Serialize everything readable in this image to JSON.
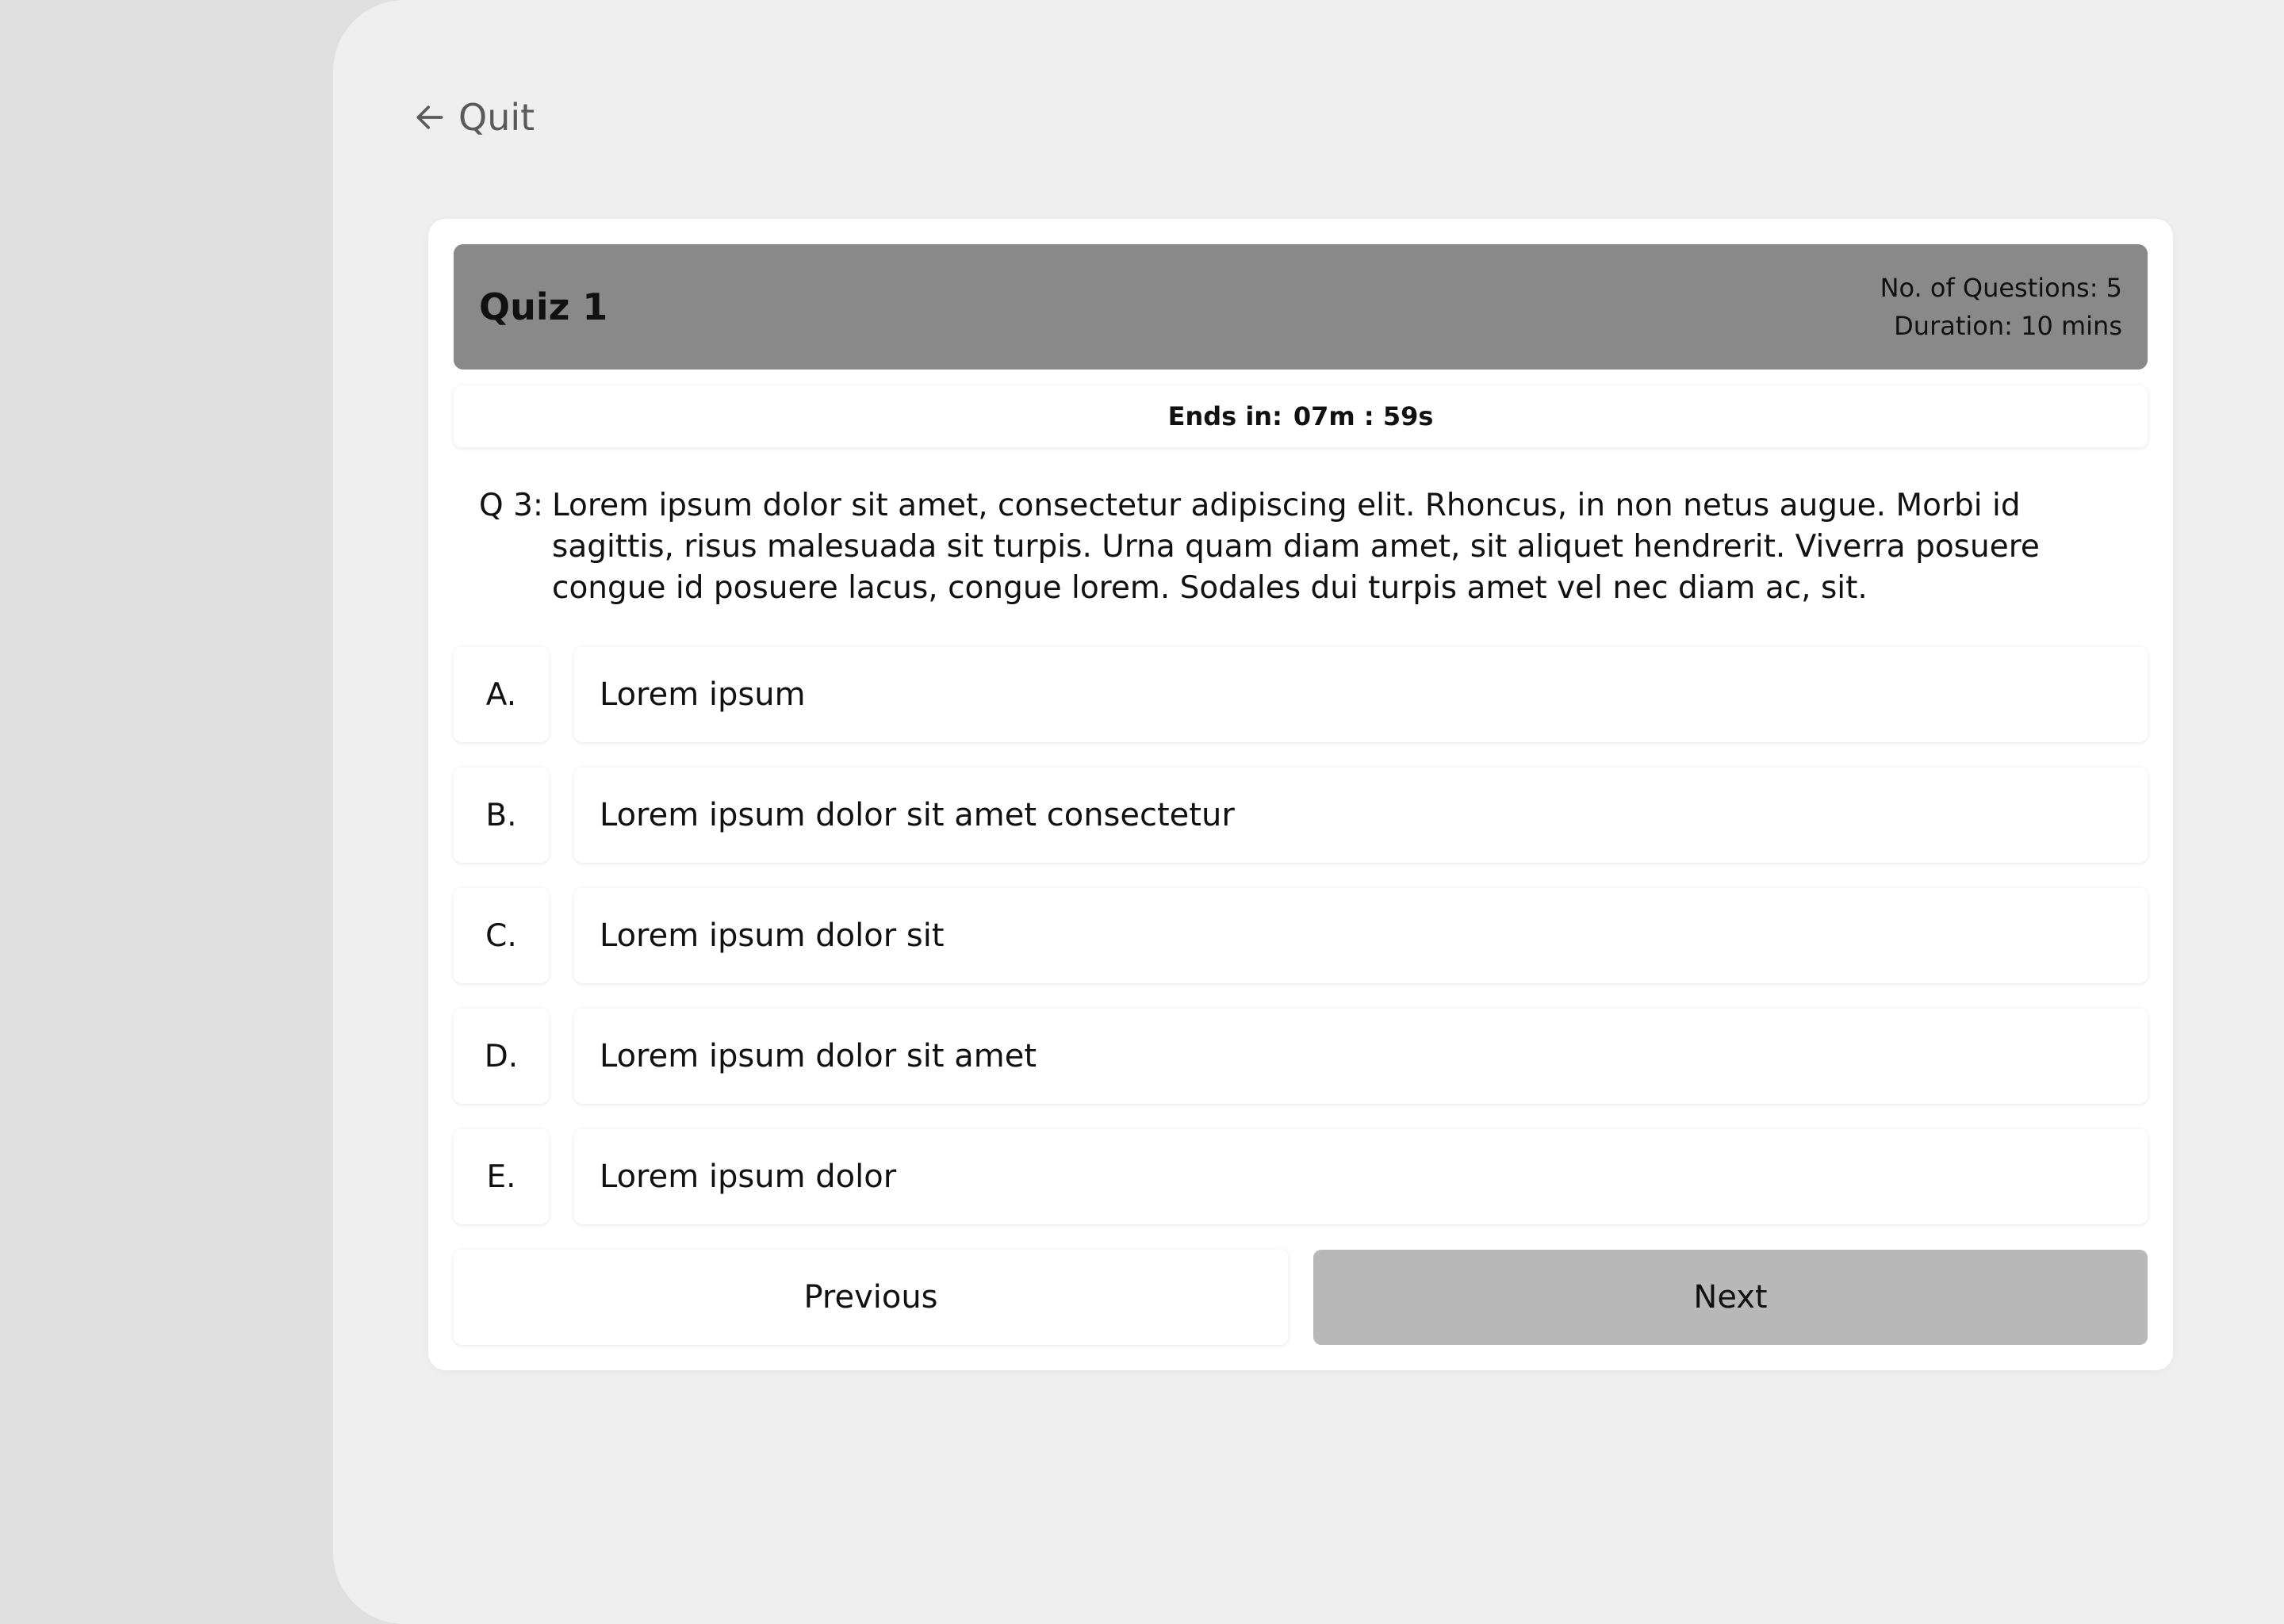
{
  "nav": {
    "quit_label": "Quit",
    "quit_icon": "arrow-left-icon"
  },
  "quiz": {
    "title": "Quiz 1",
    "questions_label": "No. of Questions:",
    "questions_count": "5",
    "duration_label": "Duration:",
    "duration_value": "10 mins"
  },
  "timer": {
    "label": "Ends in:",
    "value": "07m : 59s"
  },
  "question": {
    "number": "Q 3:",
    "text": "Lorem ipsum dolor sit amet, consectetur adipiscing elit. Rhoncus, in non netus augue. Morbi id sagittis, risus malesuada sit turpis. Urna quam diam amet, sit aliquet hendrerit. Viverra posuere congue id posuere lacus, congue lorem. Sodales dui turpis amet vel nec diam ac, sit."
  },
  "options": [
    {
      "letter": "A.",
      "text": "Lorem ipsum"
    },
    {
      "letter": "B.",
      "text": "Lorem ipsum dolor sit amet consectetur"
    },
    {
      "letter": "C.",
      "text": "Lorem ipsum dolor sit"
    },
    {
      "letter": "D.",
      "text": "Lorem ipsum dolor sit amet"
    },
    {
      "letter": "E.",
      "text": "Lorem ipsum dolor"
    }
  ],
  "buttons": {
    "previous": "Previous",
    "next": "Next"
  },
  "colors": {
    "page_background": "#e0e0e0",
    "surface": "#efefef",
    "card": "#ffffff",
    "header": "#898989",
    "next_button": "#b8b8b8"
  }
}
